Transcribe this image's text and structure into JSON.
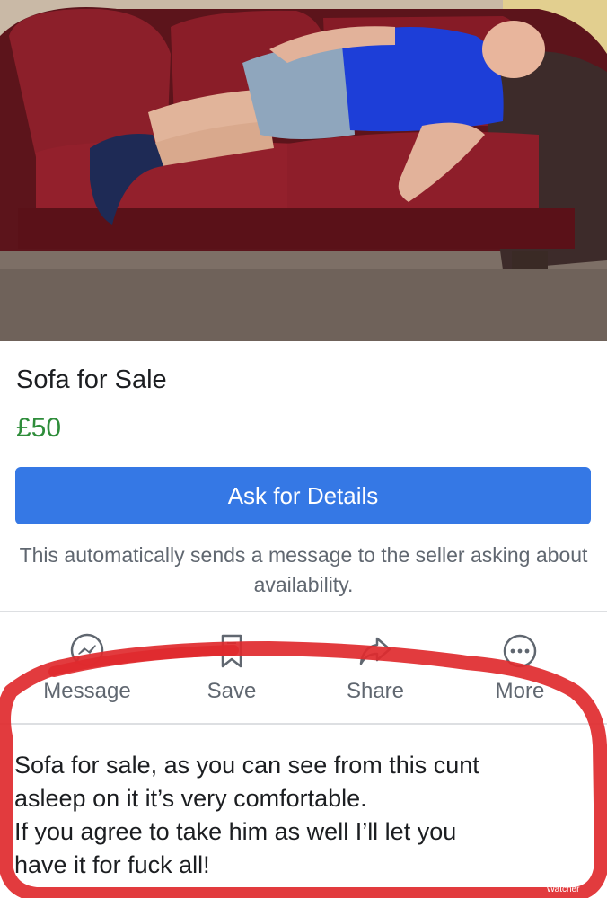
{
  "listing": {
    "title": "Sofa for Sale",
    "price": "£50",
    "button_label": "Ask for Details",
    "note": "This automatically sends a message to the seller asking about availability."
  },
  "actions": [
    {
      "label": "Message",
      "icon": "messenger-icon"
    },
    {
      "label": "Save",
      "icon": "bookmark-icon"
    },
    {
      "label": "Share",
      "icon": "share-icon"
    },
    {
      "label": "More",
      "icon": "more-icon"
    }
  ],
  "description": {
    "lines": [
      "Sofa for sale, as you can see from this cunt",
      "asleep on it it’s very comfortable.",
      "If you agree to take him as well I’ll let you",
      "have it for fuck all!"
    ]
  },
  "watermark": {
    "line1": "Shown at",
    "line2": "Watcher"
  },
  "colors": {
    "button": "#3578e5",
    "price": "#2f8d3b",
    "marker": "#e02a2e",
    "sofa": "#7a1820"
  }
}
